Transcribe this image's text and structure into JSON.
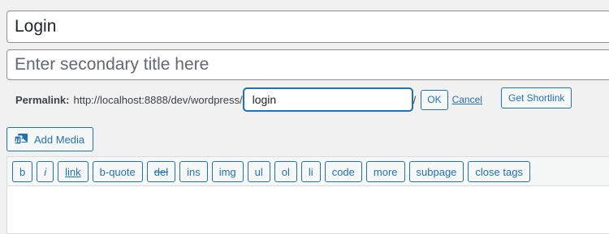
{
  "title": {
    "value": "Login"
  },
  "subtitle": {
    "placeholder": "Enter secondary title here"
  },
  "permalink": {
    "label": "Permalink:",
    "base_url": "http://localhost:8888/dev/wordpress/",
    "slug": "login",
    "trailing": "/",
    "ok_label": "OK",
    "cancel_label": "Cancel",
    "shortlink_label": "Get Shortlink"
  },
  "media": {
    "add_label": "Add Media",
    "icon": "add-media-icon"
  },
  "quicktags": [
    "b",
    "i",
    "link",
    "b-quote",
    "del",
    "ins",
    "img",
    "ul",
    "ol",
    "li",
    "code",
    "more",
    "subpage",
    "close tags"
  ],
  "colors": {
    "accent": "#2271b1",
    "background": "#f1f1f1",
    "toolbar": "#f6f7f7"
  }
}
